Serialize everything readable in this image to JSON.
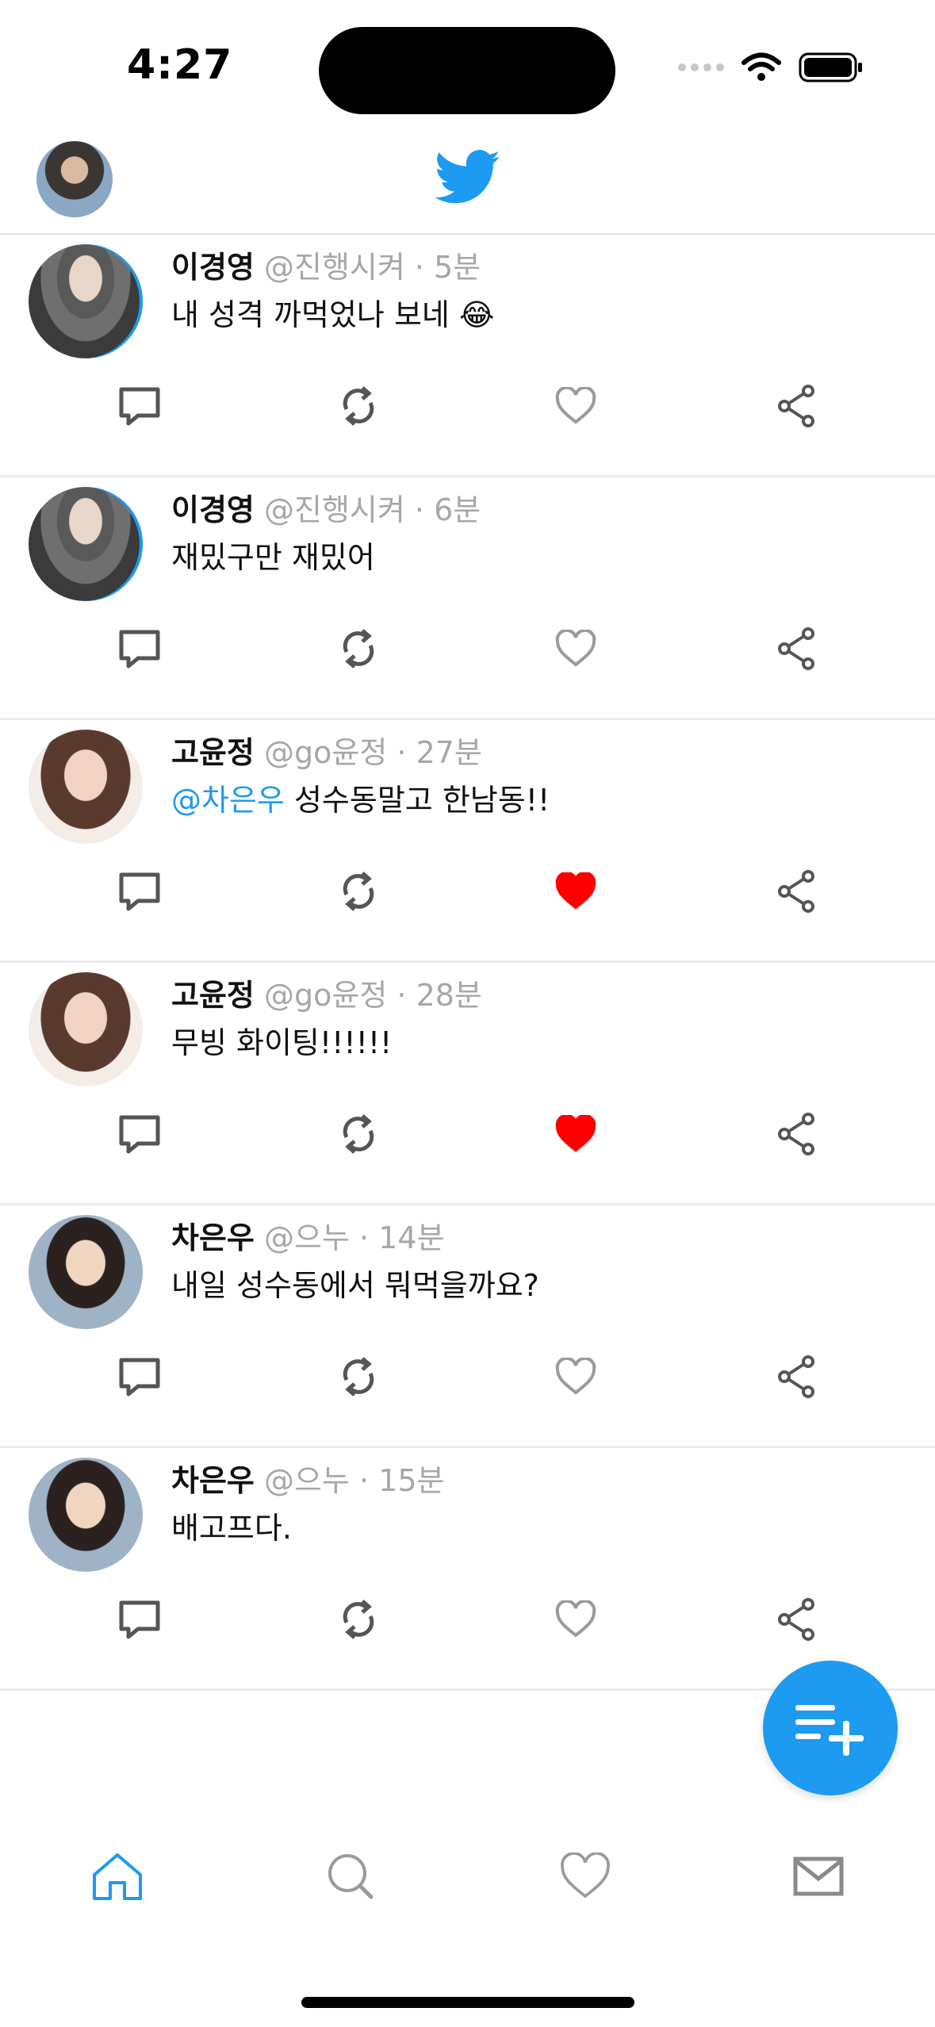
{
  "status_bar": {
    "time": "4:27"
  },
  "header": {
    "logo_icon": "twitter-bird-icon",
    "brand_color": "#1d9bf0"
  },
  "tweets": [
    {
      "name": "이경영",
      "handle": "@진행시켜",
      "dot": "·",
      "time_ago": "5분",
      "mention": "",
      "text": "내 성격 까먹었나 보네 😂",
      "liked": false,
      "avatar": "lee"
    },
    {
      "name": "이경영",
      "handle": "@진행시켜",
      "dot": "·",
      "time_ago": "6분",
      "mention": "",
      "text": "재밌구만 재밌어",
      "liked": false,
      "avatar": "lee"
    },
    {
      "name": "고윤정",
      "handle": "@go윤정",
      "dot": "·",
      "time_ago": "27분",
      "mention": "@차은우",
      "text": " 성수동말고 한남동!!",
      "liked": true,
      "avatar": "go"
    },
    {
      "name": "고윤정",
      "handle": "@go윤정",
      "dot": "·",
      "time_ago": "28분",
      "mention": "",
      "text": "무빙 화이팅!!!!!!",
      "liked": true,
      "avatar": "go"
    },
    {
      "name": "차은우",
      "handle": "@으누",
      "dot": "·",
      "time_ago": "14분",
      "mention": "",
      "text": "내일 성수동에서 뭐먹을까요?",
      "liked": false,
      "avatar": "cha"
    },
    {
      "name": "차은우",
      "handle": "@으누",
      "dot": "·",
      "time_ago": "15분",
      "mention": "",
      "text": "배고프다.",
      "liked": false,
      "avatar": "cha"
    }
  ],
  "colors": {
    "like_active": "#ff0000",
    "icon_gray": "#555555",
    "icon_light": "#9a9a9a",
    "accent": "#1d9bf0"
  },
  "tabbar": [
    "home-icon",
    "search-icon",
    "heart-icon",
    "mail-icon"
  ]
}
